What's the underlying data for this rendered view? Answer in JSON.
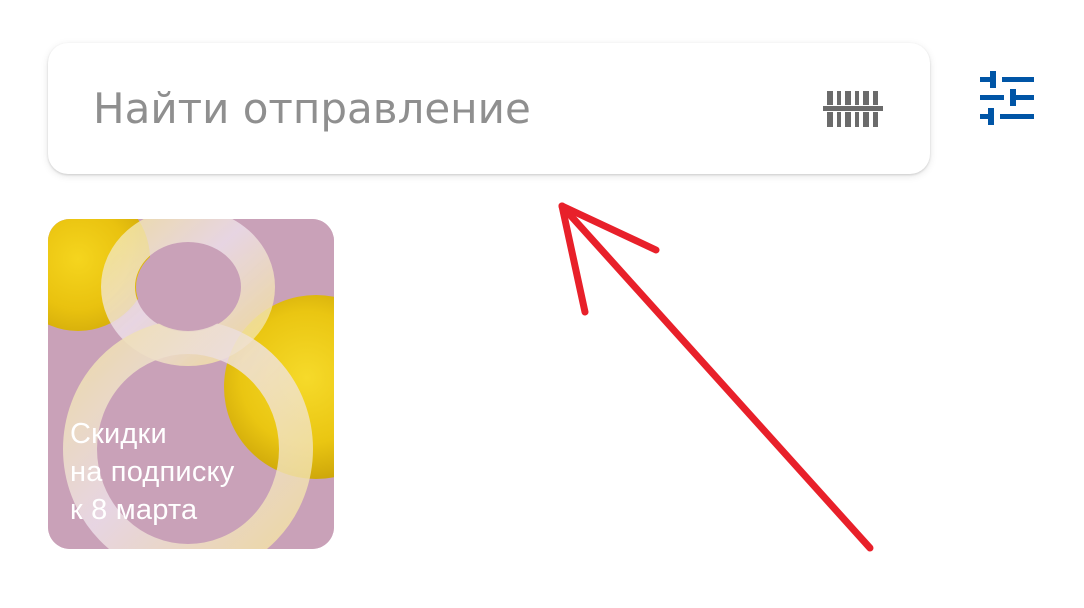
{
  "search": {
    "placeholder": "Найти отправление"
  },
  "icons": {
    "barcode": "barcode-scan-icon",
    "filter": "filter-sliders-icon"
  },
  "promo": {
    "line1": "Скидки",
    "line2": "на подписку",
    "line3": "к 8 марта",
    "big_digit": "8"
  },
  "colors": {
    "accent": "#0055a6",
    "placeholder": "#8f8f8f",
    "promo_bg": "#c9a1b8",
    "annotation": "#e8202a"
  }
}
